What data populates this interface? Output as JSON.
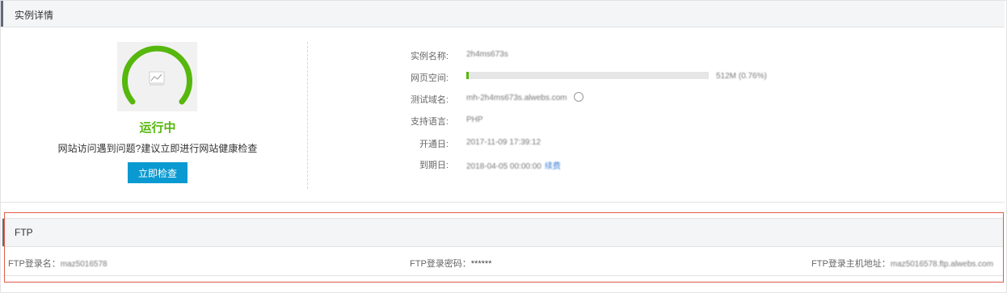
{
  "detail": {
    "title": "实例详情",
    "status": "运行中",
    "hint": "网站访问遇到问题?建议立即进行网站健康检查",
    "check_button": "立即检查",
    "info": [
      {
        "label": "实例名称:",
        "value": "2h4ms673s"
      },
      {
        "label": "网页空间:",
        "value": "512M (0.76%)"
      },
      {
        "label": "测试域名:",
        "value": "mh-2h4ms673s.alwebs.com"
      },
      {
        "label": "支持语言:",
        "value": "PHP"
      },
      {
        "label": "开通日:",
        "value": "2017-11-09 17:39:12"
      },
      {
        "label": "到期日:",
        "value": "2018-04-05 00:00:00",
        "link": "续费"
      }
    ],
    "space_usage_fraction": 0.0076
  },
  "ftp": {
    "title": "FTP",
    "login_name_label": "FTP登录名：",
    "login_name_value": "maz5016578",
    "password_label": "FTP登录密码：",
    "password_value": "******",
    "host_label": "FTP登录主机地址：",
    "host_value": "maz5016578.ftp.alwebs.com"
  },
  "colors": {
    "status_green": "#56b70d",
    "button_blue": "#0a9ad1",
    "highlight_red": "#e05a4a"
  },
  "icons": [
    "gauge-icon",
    "chart-icon",
    "copy-icon"
  ]
}
